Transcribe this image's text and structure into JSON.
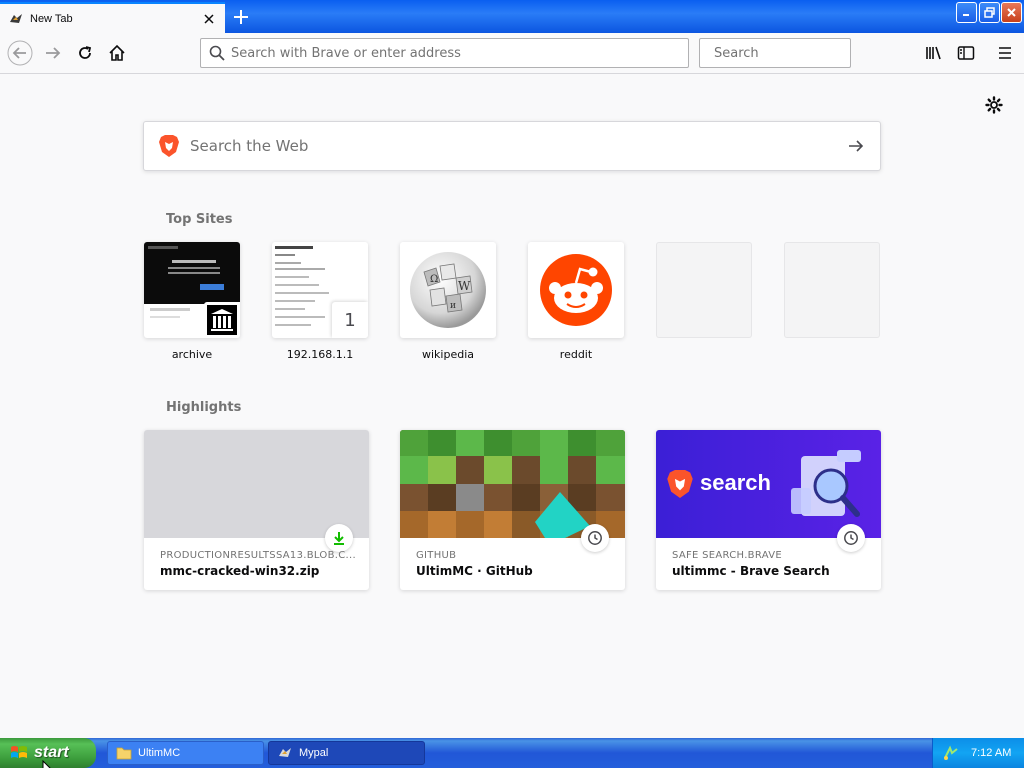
{
  "window": {
    "tab_title": "New Tab",
    "new_tab_label": "+"
  },
  "navbar": {
    "url_placeholder": "Search with Brave or enter address",
    "search_placeholder": "Search"
  },
  "newtab": {
    "web_search_placeholder": "Search the Web",
    "top_sites_title": "Top Sites",
    "top_sites": [
      {
        "label": "archive"
      },
      {
        "label": "192.168.1.1",
        "badge": "1"
      },
      {
        "label": "wikipedia"
      },
      {
        "label": "reddit"
      }
    ],
    "highlights_title": "Highlights",
    "highlights": [
      {
        "context": "PRODUCTIONRESULTSSA13.BLOB.C...",
        "title": "mmc-cracked-win32.zip",
        "type_icon": "download-icon"
      },
      {
        "context": "GITHUB",
        "title": "UltimMC · GitHub",
        "type_icon": "clock-icon"
      },
      {
        "context": "SAFE SEARCH.BRAVE",
        "title": "ultimmc - Brave Search",
        "type_icon": "clock-icon",
        "preview_text": "search"
      }
    ]
  },
  "taskbar": {
    "start_label": "start",
    "tasks": [
      {
        "label": "UltimMC"
      },
      {
        "label": "Mypal"
      }
    ],
    "clock": "7:12 AM"
  },
  "colors": {
    "brave_orange": "#fb542b",
    "reddit_orange": "#ff4500",
    "accent_blue": "#0a84ff"
  }
}
